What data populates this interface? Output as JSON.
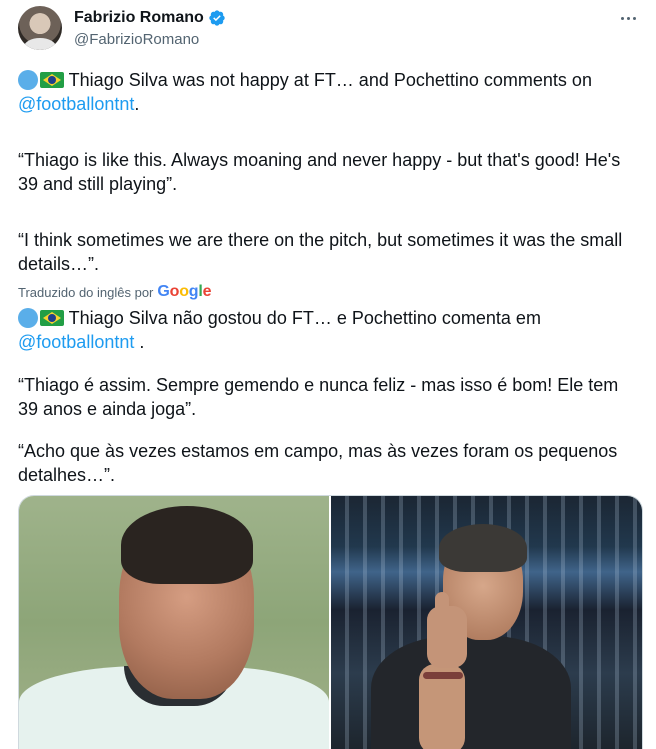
{
  "author": {
    "name": "Fabrizio Romano",
    "handle": "@FabrizioRomano",
    "avatar_icon": "avatar-photo",
    "verified_icon": "verified-badge-icon",
    "verified_color": "#1d9bf0"
  },
  "more_icon": "more-options-icon",
  "original": {
    "line1_text": " Thiago Silva was not happy at FT… and Pochettino comments on",
    "line1_mention": "@footballontnt",
    "line1_end": ".",
    "quote1": "“Thiago is like this. Always moaning and never happy - but that's good! He's 39 and still playing”.",
    "quote2": "“I think sometimes we are there on the pitch, but sometimes it was the small details…”."
  },
  "translation": {
    "label": "Traduzido do inglês por",
    "google_letters": [
      "G",
      "o",
      "o",
      "g",
      "l",
      "e"
    ]
  },
  "translated": {
    "line1_text": " Thiago Silva não gostou do FT… e Pochettino comenta em",
    "line1_mention": "@footballontnt",
    "line1_end": " .",
    "quote1": "“Thiago é assim. Sempre gemendo e nunca feliz - mas isso é bom! Ele tem 39 anos e ainda joga”.",
    "quote2": "“Acho que às vezes estamos em campo, mas às vezes foram os pequenos detalhes…”."
  },
  "media": {
    "left_photo": "thiago-silva-photo",
    "right_photo": "pochettino-thumbs-up-photo"
  },
  "colors": {
    "link": "#1d9bf0",
    "secondary_text": "#536471"
  }
}
